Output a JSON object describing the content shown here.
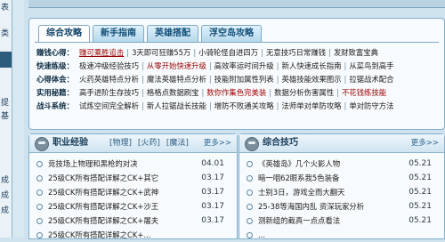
{
  "left_strip": {
    "items": [
      "表",
      "类",
      "提",
      "基",
      "成",
      "成",
      "成"
    ]
  },
  "guide_panel": {
    "tabs": [
      {
        "label": "综合攻略"
      },
      {
        "label": "新手指南"
      },
      {
        "label": "英雄搭配"
      },
      {
        "label": "浮空岛攻略"
      }
    ],
    "rows": [
      {
        "label": "赚钱心得：",
        "items": [
          {
            "text": "赚可乘胜追击",
            "hl": true,
            "ul": true
          },
          {
            "text": "3天即可狂赚55万"
          },
          {
            "text": "小骑轮怪自进四万"
          },
          {
            "text": "无意技巧日常赚钱"
          },
          {
            "text": "发财致富宝典"
          }
        ]
      },
      {
        "label": "快速练级：",
        "items": [
          {
            "text": "极速冲级经验技巧"
          },
          {
            "text": "从零开始快速升级",
            "hl": true
          },
          {
            "text": "高效率运时间升级"
          },
          {
            "text": "新人快速成长指南"
          },
          {
            "text": "从菜鸟到高手"
          }
        ]
      },
      {
        "label": "心得体会：",
        "items": [
          {
            "text": "火药英雄特点分析"
          },
          {
            "text": "魔法英雄特点分析"
          },
          {
            "text": "技能附加属性列表"
          },
          {
            "text": "英雄技能效果图示"
          },
          {
            "text": "拉锯战术配合"
          }
        ]
      },
      {
        "label": "实用秘籍：",
        "items": [
          {
            "text": "高手进阶生存技巧"
          },
          {
            "text": "格格点数据刷宝"
          },
          {
            "text": "数你作集色完美装",
            "hl": true
          },
          {
            "text": "数据分析伤害属性"
          },
          {
            "text": "不花钱练技能",
            "hl": true
          }
        ]
      },
      {
        "label": "战斗系统：",
        "items": [
          {
            "text": "试炼空间完全解析"
          },
          {
            "text": "新人拉锯战长技能"
          },
          {
            "text": "增防不败通关攻略"
          },
          {
            "text": "法师单对单防攻略"
          },
          {
            "text": "单对防守方法"
          }
        ]
      }
    ]
  },
  "career_box": {
    "title": "职业经验",
    "tags": [
      "[物理]",
      "[火药]",
      "[魔法]"
    ],
    "more": "更多>>",
    "items": [
      {
        "text": "竞技场上物理和黑枪的对决",
        "date": "04.01"
      },
      {
        "text": "25级CK所有搭配详解之CK+其它",
        "date": "03.17"
      },
      {
        "text": "25级CK所有搭配详解之CK+武神",
        "date": "03.17"
      },
      {
        "text": "25级CK所有搭配详解之CK+沙王",
        "date": "03.17"
      },
      {
        "text": "25级CK所有搭配详解之CK+屠夫",
        "date": "03.17"
      },
      {
        "text": "25级CK所有搭配详解之CK+...",
        "date": ""
      }
    ]
  },
  "tips_box": {
    "title": "综合技巧",
    "more": "更多>>",
    "items": [
      {
        "text": "《英雄岛》几个火影人物",
        "date": "05.21"
      },
      {
        "text": "暗一咽62眼系我5色装备",
        "date": "05.21"
      },
      {
        "text": "士别3日，游戏全而大翻天",
        "date": "05.21"
      },
      {
        "text": "25-38等海国内乱 资深玩家分析",
        "date": "05.21"
      },
      {
        "text": "测新组的截真一点点看法",
        "date": "05.21"
      },
      {
        "text": "...",
        "date": ""
      }
    ]
  }
}
